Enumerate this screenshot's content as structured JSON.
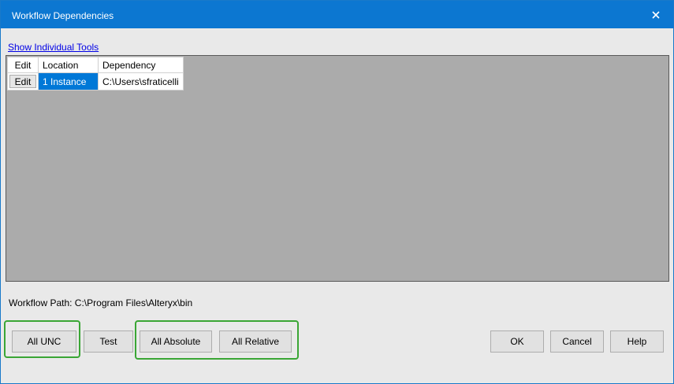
{
  "window": {
    "title": "Workflow Dependencies",
    "close_glyph": "✕",
    "accent_color": "#0c77d1"
  },
  "link": {
    "label": "Show Individual Tools"
  },
  "grid": {
    "headers": {
      "edit": "Edit",
      "location": "Location",
      "dependency": "Dependency"
    },
    "rows": [
      {
        "edit": "Edit",
        "location": "1 Instance",
        "dependency": "C:\\Users\\sfraticelli"
      }
    ]
  },
  "workflow_path": {
    "label": "Workflow Path: C:\\Program Files\\Alteryx\\bin"
  },
  "buttons": {
    "all_unc": "All UNC",
    "test": "Test",
    "all_absolute": "All Absolute",
    "all_relative": "All Relative",
    "ok": "OK",
    "cancel": "Cancel",
    "help": "Help"
  },
  "highlight_color": "#3aa635"
}
